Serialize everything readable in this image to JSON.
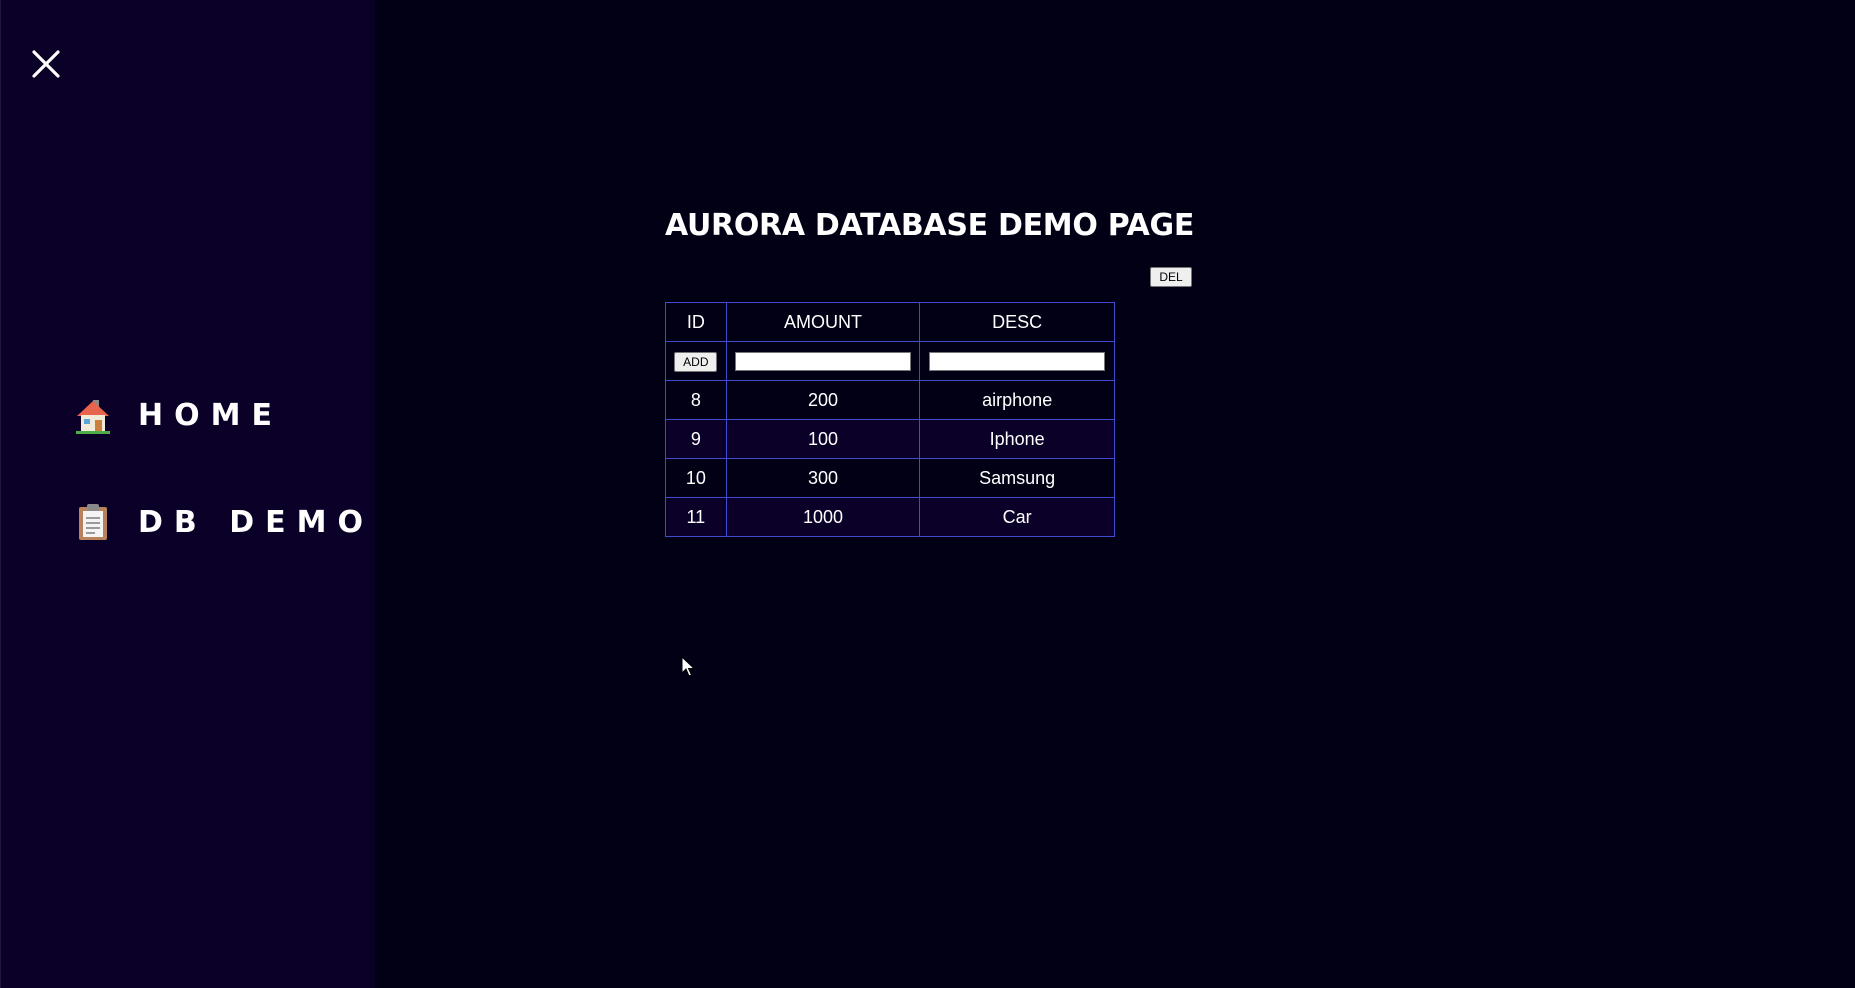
{
  "sidebar": {
    "close_icon": "close-icon",
    "items": [
      {
        "label": "HOME",
        "icon": "house-icon"
      },
      {
        "label": "DB DEMO",
        "icon": "clipboard-icon"
      }
    ]
  },
  "main": {
    "title": "AURORA DATABASE DEMO PAGE",
    "del_label": "DEL",
    "table": {
      "headers": [
        "ID",
        "AMOUNT",
        "DESC"
      ],
      "add_label": "ADD",
      "amount_input_value": "",
      "desc_input_value": "",
      "rows": [
        {
          "id": "8",
          "amount": "200",
          "desc": "airphone"
        },
        {
          "id": "9",
          "amount": "100",
          "desc": "Iphone"
        },
        {
          "id": "10",
          "amount": "300",
          "desc": "Samsung"
        },
        {
          "id": "11",
          "amount": "1000",
          "desc": "Car"
        }
      ]
    }
  },
  "colors": {
    "page_background": "#020015",
    "sidebar_background": "#0b0027",
    "table_border": "#3f4bd1",
    "text": "#ffffff"
  }
}
